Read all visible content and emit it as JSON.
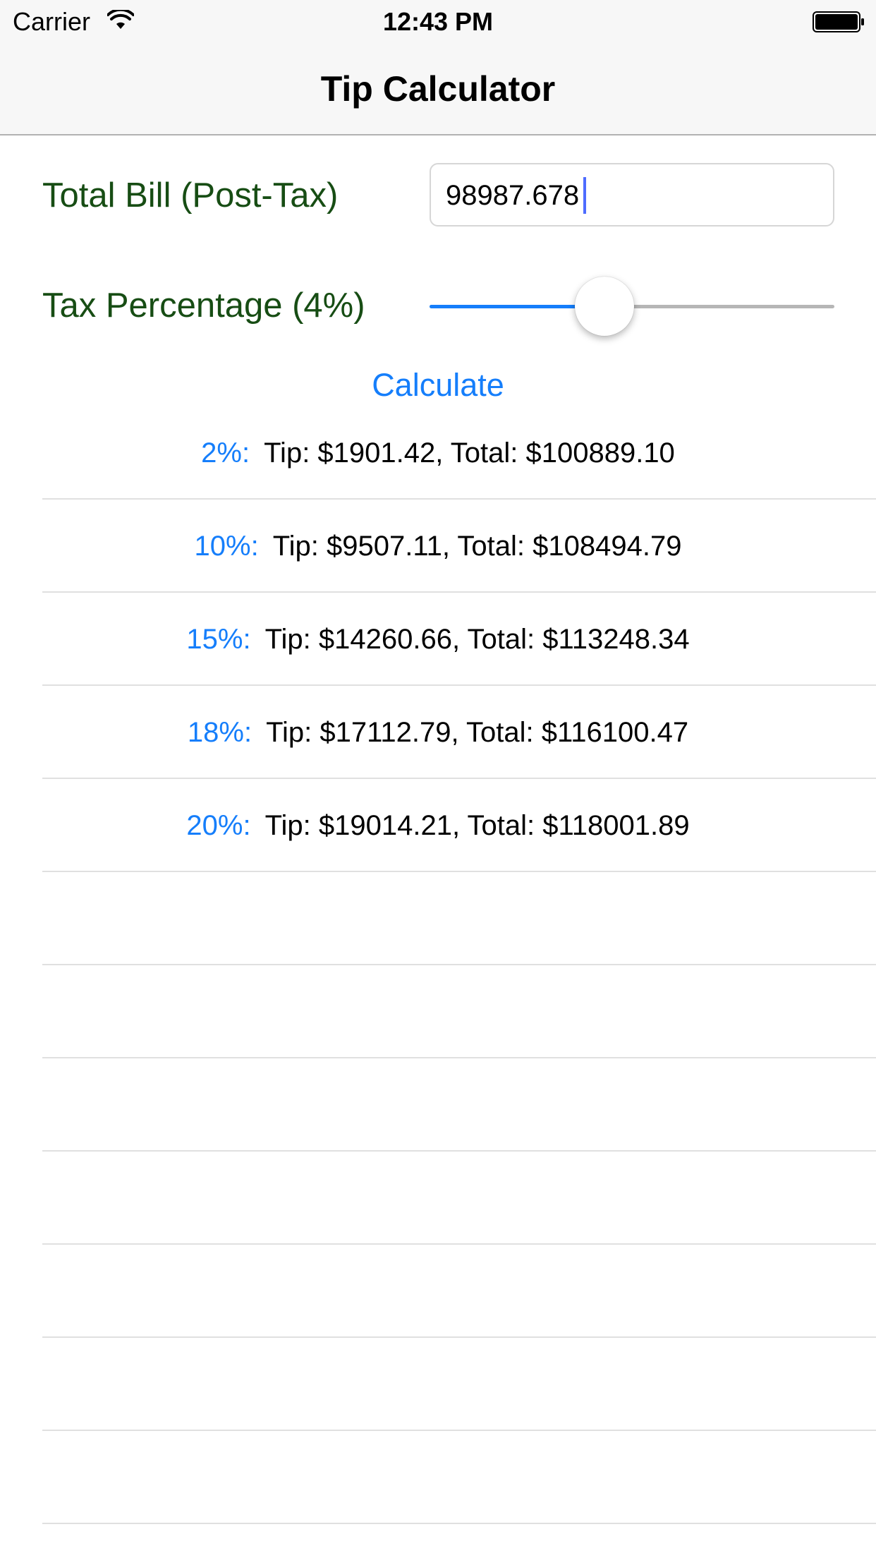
{
  "status_bar": {
    "carrier": "Carrier",
    "time": "12:43 PM"
  },
  "nav": {
    "title": "Tip Calculator"
  },
  "form": {
    "bill_label": "Total Bill (Post-Tax)",
    "bill_value": "98987.678",
    "tax_label": "Tax Percentage (4%)",
    "tax_slider_fraction": 0.42,
    "calculate_label": "Calculate"
  },
  "results": [
    {
      "percent": "2%:",
      "text": "Tip: $1901.42, Total: $100889.10"
    },
    {
      "percent": "10%:",
      "text": "Tip: $9507.11, Total: $108494.79"
    },
    {
      "percent": "15%:",
      "text": "Tip: $14260.66, Total: $113248.34"
    },
    {
      "percent": "18%:",
      "text": "Tip: $17112.79, Total: $116100.47"
    },
    {
      "percent": "20%:",
      "text": "Tip: $19014.21, Total: $118001.89"
    }
  ],
  "colors": {
    "accent": "#157efb",
    "label_green": "#174d14",
    "separator": "#e0e0e0"
  }
}
